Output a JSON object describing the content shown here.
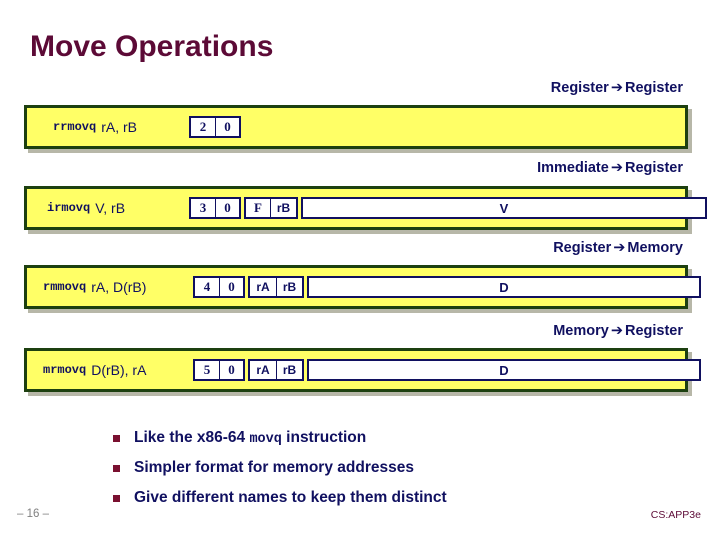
{
  "slide": {
    "title": "Move Operations",
    "page_number": "– 16 –",
    "brand": "CS:APP3e"
  },
  "colors": {
    "title": "#5c0a36",
    "panel_fill": "#ffff66",
    "panel_border": "#1d4010",
    "ink": "#101060",
    "bullet_marker": "#7a1030",
    "page_number": "#808080"
  },
  "sections": [
    {
      "caption_from": "Register",
      "caption_arrow": "➔",
      "caption_to": "Register",
      "label_mono": "rrmovq",
      "label_sans": "rA, rB",
      "fields": [
        {
          "cells": [
            {
              "text": "2",
              "kind": "code"
            },
            {
              "text": "0",
              "kind": "code"
            }
          ]
        }
      ]
    },
    {
      "caption_from": "Immediate",
      "caption_arrow": "➔",
      "caption_to": "Register",
      "label_mono": "irmovq",
      "label_sans": "V, rB",
      "fields": [
        {
          "cells": [
            {
              "text": "3",
              "kind": "code"
            },
            {
              "text": "0",
              "kind": "code"
            }
          ]
        },
        {
          "cells": [
            {
              "text": "F",
              "kind": "code"
            },
            {
              "text": "rB",
              "kind": "reg"
            }
          ]
        },
        {
          "cells": [
            {
              "text": "V",
              "kind": "wide"
            }
          ]
        }
      ]
    },
    {
      "caption_from": "Register",
      "caption_arrow": "➔",
      "caption_to": "Memory",
      "label_mono": "rmmovq",
      "label_sans": "rA, D(rB)",
      "fields": [
        {
          "cells": [
            {
              "text": "4",
              "kind": "code"
            },
            {
              "text": "0",
              "kind": "code"
            }
          ]
        },
        {
          "cells": [
            {
              "text": "rA",
              "kind": "reg"
            },
            {
              "text": "rB",
              "kind": "reg"
            }
          ]
        },
        {
          "cells": [
            {
              "text": "D",
              "kind": "wide"
            }
          ]
        }
      ]
    },
    {
      "caption_from": "Memory",
      "caption_arrow": "➔",
      "caption_to": "Register",
      "label_mono": "mrmovq",
      "label_sans": "D(rB), rA",
      "fields": [
        {
          "cells": [
            {
              "text": "5",
              "kind": "code"
            },
            {
              "text": "0",
              "kind": "code"
            }
          ]
        },
        {
          "cells": [
            {
              "text": "rA",
              "kind": "reg"
            },
            {
              "text": "rB",
              "kind": "reg"
            }
          ]
        },
        {
          "cells": [
            {
              "text": "D",
              "kind": "wide"
            }
          ]
        }
      ]
    }
  ],
  "bullets": [
    {
      "pre": "Like the x86-64 ",
      "mono": "movq",
      "post": " instruction"
    },
    {
      "pre": "Simpler format for memory addresses",
      "mono": "",
      "post": ""
    },
    {
      "pre": "Give different names to keep them distinct",
      "mono": "",
      "post": ""
    }
  ]
}
